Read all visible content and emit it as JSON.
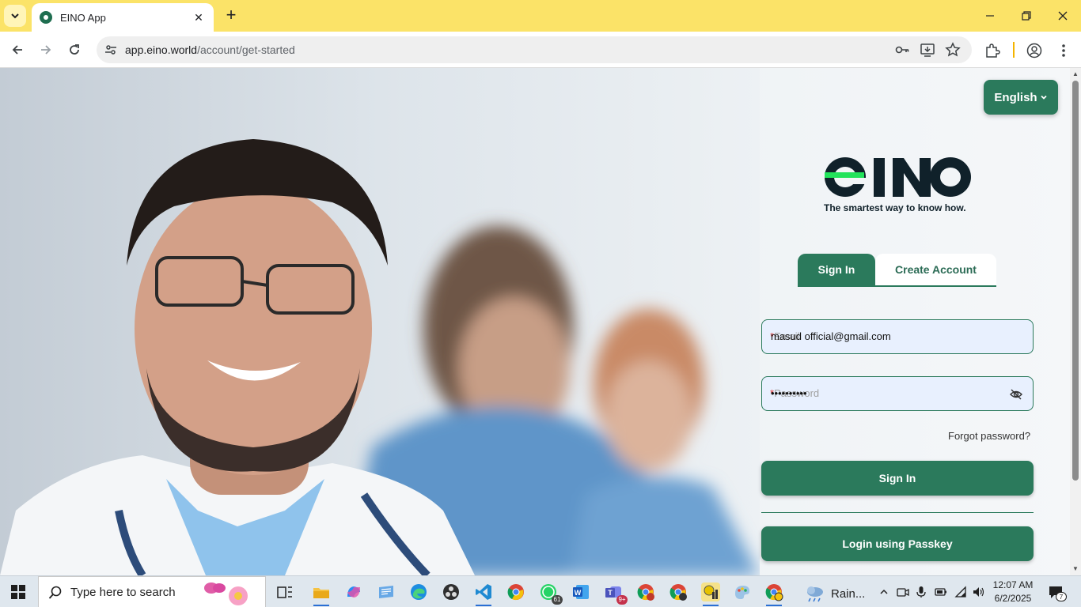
{
  "browser": {
    "tab_title": "EINO App",
    "url_host": "app.eino.world",
    "url_path": "/account/get-started"
  },
  "page": {
    "language_label": "English",
    "brand": "EINO",
    "tagline": "The smartest way to know how.",
    "tabs": [
      {
        "label": "Sign In",
        "active": true
      },
      {
        "label": "Create Account",
        "active": false
      }
    ],
    "email": {
      "label": "Email",
      "value": "masud official@gmail.com"
    },
    "password": {
      "label": "Password",
      "value": "••••••••••"
    },
    "forgot_label": "Forgot password?",
    "signin_label": "Sign In",
    "passkey_label": "Login using Passkey",
    "brand_color": "#2b7a5c",
    "accent_green": "#22e35b"
  },
  "taskbar": {
    "search_placeholder": "Type here to search",
    "whatsapp_badge": "61",
    "teams_badge": "9+",
    "weather_label": "Rain...",
    "time": "12:07 AM",
    "date": "6/2/2025",
    "notification_count": "7"
  }
}
